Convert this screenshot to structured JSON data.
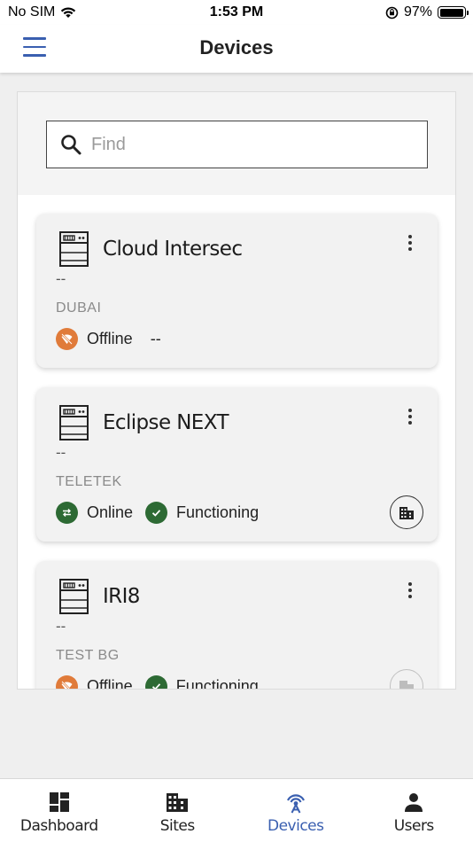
{
  "status_bar": {
    "carrier": "No SIM",
    "time": "1:53 PM",
    "battery_percent": "97%",
    "battery_level": 0.97
  },
  "header": {
    "title": "Devices",
    "menu_icon": "hamburger-menu-icon"
  },
  "search": {
    "placeholder": "Find",
    "value": ""
  },
  "devices": [
    {
      "name": "Cloud Intersec",
      "description": "--",
      "site": "DUBAI",
      "connection": "Offline",
      "connection_state": "offline",
      "state": "--",
      "state_has_icon": false,
      "building_button": false
    },
    {
      "name": "Eclipse NEXT",
      "description": "--",
      "site": "TELETEK",
      "connection": "Online",
      "connection_state": "online",
      "state": "Functioning",
      "state_has_icon": true,
      "building_button": true
    },
    {
      "name": "IRI8",
      "description": "--",
      "site": "TEST BG",
      "connection": "Offline",
      "connection_state": "offline",
      "state": "Functioning",
      "state_has_icon": true,
      "building_button": true
    }
  ],
  "bottom_nav": [
    {
      "label": "Dashboard",
      "icon": "dashboard-icon",
      "active": false
    },
    {
      "label": "Sites",
      "icon": "building-icon",
      "active": false
    },
    {
      "label": "Devices",
      "icon": "antenna-icon",
      "active": true
    },
    {
      "label": "Users",
      "icon": "user-icon",
      "active": false
    }
  ],
  "colors": {
    "accent": "#3a5fb0",
    "offline": "#e07b3a",
    "online": "#2d6a34"
  }
}
